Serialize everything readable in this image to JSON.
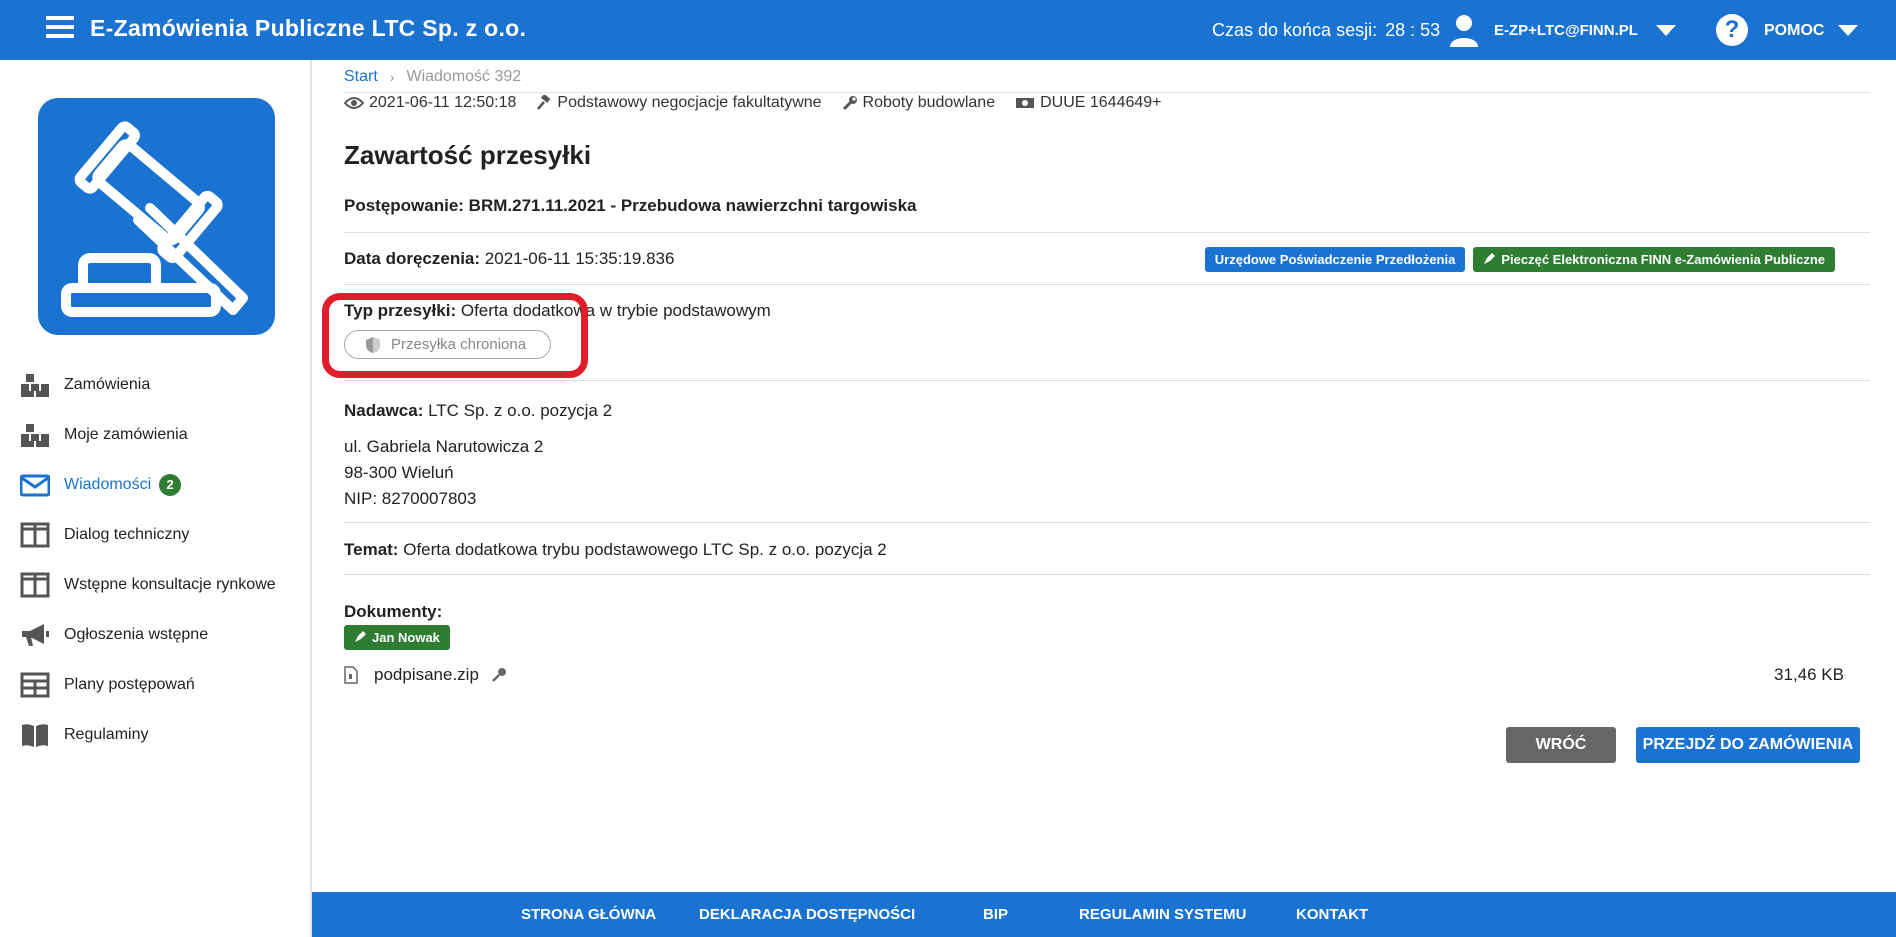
{
  "header": {
    "title": "E-Zamówienia Publiczne LTC Sp. z o.o.",
    "session_label": "Czas do końca sesji:",
    "session_timer": "28 : 53",
    "user_email": "E-ZP+LTC@FINN.PL",
    "help_label": "POMOC",
    "help_icon": "question-icon",
    "brand_color": "#1a73d1"
  },
  "sidebar": {
    "logo_icon": "gavel-icon",
    "items": [
      {
        "label": "Zamówienia",
        "icon": "boxes-icon"
      },
      {
        "label": "Moje zamówienia",
        "icon": "boxes-icon"
      },
      {
        "label": "Wiadomości",
        "icon": "envelope-icon",
        "badge": "2",
        "active": true
      },
      {
        "label": "Dialog techniczny",
        "icon": "columns-icon"
      },
      {
        "label": "Wstępne konsultacje rynkowe",
        "icon": "columns-icon"
      },
      {
        "label": "Ogłoszenia wstępne",
        "icon": "megaphone-icon"
      },
      {
        "label": "Plany postępowań",
        "icon": "table-icon"
      },
      {
        "label": "Regulaminy",
        "icon": "book-icon"
      }
    ]
  },
  "breadcrumb": {
    "start": "Start",
    "separator": "›",
    "current": "Wiadomość 392"
  },
  "meta": {
    "date": "2021-06-11 12:50:18",
    "mode": "Podstawowy negocjacje fakultatywne",
    "category": "Roboty budowlane",
    "duue": "DUUE 1644649+"
  },
  "content": {
    "title": "Zawartość przesyłki",
    "proceeding": "Postępowanie: BRM.271.11.2021 - Przebudowa nawierzchni targowiska",
    "delivery_label": "Data doręczenia:",
    "delivery_value": "2021-06-11 15:35:19.836",
    "upp_tag": "Urzędowe Poświadczenie Przedłożenia",
    "seal_tag": "Pieczęć Elektroniczna FINN e-Zamówienia Publiczne",
    "type_label": "Typ przesyłki:",
    "type_value": "Oferta dodatkowa w trybie podstawowym",
    "protected_label": "Przesyłka chroniona",
    "sender_label": "Nadawca:",
    "sender_value": "LTC Sp. z o.o. pozycja 2",
    "address_line1": "ul. Gabriela Narutowicza 2",
    "address_line2": "98-300 Wieluń",
    "address_line3": "NIP: 8270007803",
    "subject_label": "Temat:",
    "subject_value": "Oferta dodatkowa trybu podstawowego LTC Sp. z o.o. pozycja 2",
    "documents_label": "Dokumenty:",
    "signer_tag": "Jan Nowak",
    "file_name": "podpisane.zip",
    "file_size": "31,46 KB"
  },
  "actions": {
    "back": "WRÓĆ",
    "go_to_order": "PRZEJDŹ DO ZAMÓWIENIA"
  },
  "footer": {
    "links": [
      "STRONA GŁÓWNA",
      "DEKLARACJA DOSTĘPNOŚCI",
      "BIP",
      "REGULAMIN SYSTEMU",
      "KONTAKT"
    ]
  }
}
